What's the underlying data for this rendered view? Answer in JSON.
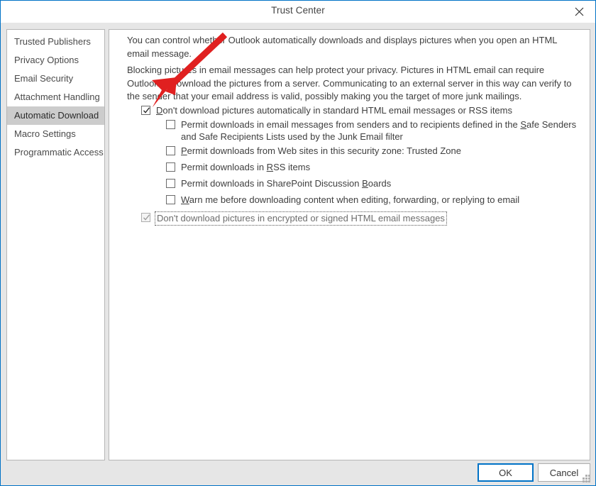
{
  "window": {
    "title": "Trust Center",
    "close_icon": "close-icon",
    "accent_color": "#0072c6",
    "selection_color": "#cccccc",
    "annotation_color": "#e02020"
  },
  "sidebar": {
    "items": [
      {
        "label": "Trusted Publishers",
        "selected": false
      },
      {
        "label": "Privacy Options",
        "selected": false
      },
      {
        "label": "Email Security",
        "selected": false
      },
      {
        "label": "Attachment Handling",
        "selected": false
      },
      {
        "label": "Automatic Download",
        "selected": true
      },
      {
        "label": "Macro Settings",
        "selected": false
      },
      {
        "label": "Programmatic Access",
        "selected": false
      }
    ]
  },
  "content": {
    "paragraph1": "You can control whether Outlook automatically downloads and displays pictures when you open an HTML email message.",
    "paragraph2": "Blocking pictures in email messages can help protect your privacy. Pictures in HTML email can require Outlook to download the pictures from a server. Communicating to an external server in this way can verify to the sender that your email address is valid, possibly making you the target of more junk mailings.",
    "options": [
      {
        "id": "dont-download-standard",
        "label": "Don't download pictures automatically in standard HTML email messages or RSS items",
        "accel": "D",
        "checked": true,
        "disabled": false,
        "indent": false,
        "focused": false
      },
      {
        "id": "permit-safe-senders",
        "label": "Permit downloads in email messages from senders and to recipients defined in the Safe Senders and Safe Recipients Lists used by the Junk Email filter",
        "accel": "S",
        "checked": false,
        "disabled": false,
        "indent": true,
        "focused": false
      },
      {
        "id": "permit-security-zone",
        "label": "Permit downloads from Web sites in this security zone: Trusted Zone",
        "accel": "P",
        "checked": false,
        "disabled": false,
        "indent": true,
        "focused": false
      },
      {
        "id": "permit-rss",
        "label": "Permit downloads in RSS items",
        "accel": "R",
        "checked": false,
        "disabled": false,
        "indent": true,
        "focused": false
      },
      {
        "id": "permit-sharepoint",
        "label": "Permit downloads in SharePoint Discussion Boards",
        "accel": "B",
        "checked": false,
        "disabled": false,
        "indent": true,
        "focused": false
      },
      {
        "id": "warn-before-download",
        "label": "Warn me before downloading content when editing, forwarding, or replying to email",
        "accel": "W",
        "checked": false,
        "disabled": false,
        "indent": true,
        "focused": false
      },
      {
        "id": "dont-download-encrypted",
        "label": "Don't download pictures in encrypted or signed HTML email messages",
        "accel": "",
        "checked": true,
        "disabled": true,
        "indent": false,
        "focused": true
      }
    ]
  },
  "footer": {
    "ok_label": "OK",
    "cancel_label": "Cancel"
  }
}
